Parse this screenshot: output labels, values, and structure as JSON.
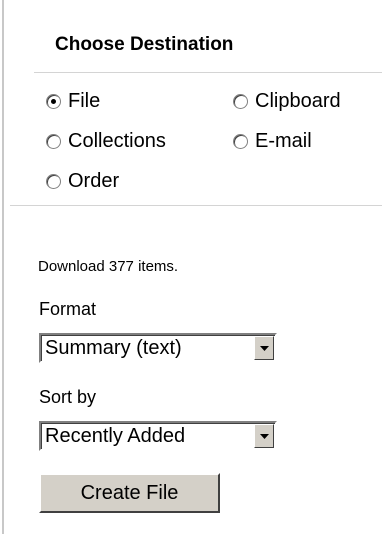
{
  "destination": {
    "title": "Choose Destination",
    "options": [
      {
        "label": "File",
        "checked": true
      },
      {
        "label": "Clipboard",
        "checked": false
      },
      {
        "label": "Collections",
        "checked": false
      },
      {
        "label": "E-mail",
        "checked": false
      },
      {
        "label": "Order",
        "checked": false
      }
    ]
  },
  "download": {
    "summary": "Download 377 items."
  },
  "format": {
    "label": "Format",
    "selected": "Summary (text)"
  },
  "sort": {
    "label": "Sort by",
    "selected": "Recently Added"
  },
  "actions": {
    "create_label": "Create File"
  },
  "icons": {
    "dropdown": "dropdown-arrow-icon"
  }
}
